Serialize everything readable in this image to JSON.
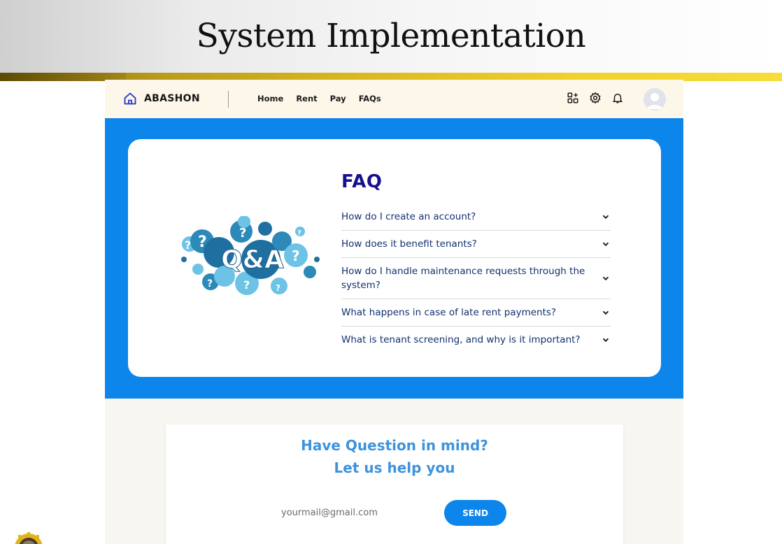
{
  "slide": {
    "title": "System Implementation"
  },
  "navbar": {
    "brand": "ABASHON",
    "links": [
      "Home",
      "Rent",
      "Pay",
      "FAQs"
    ],
    "icons": [
      "apps-add-icon",
      "gear-icon",
      "bell-icon"
    ]
  },
  "faq": {
    "title": "FAQ",
    "image_text": "Q&A",
    "items": [
      {
        "question": "How do I create an account?"
      },
      {
        "question": "How does it benefit tenants?"
      },
      {
        "question": "How do I handle maintenance requests through the system?"
      },
      {
        "question": "What happens in case of late rent payments?"
      },
      {
        "question": "What is tenant screening, and why is it important?"
      }
    ]
  },
  "help": {
    "line1": "Have Question in mind?",
    "line2": "Let us help you",
    "email_placeholder": "yourmail@gmail.com",
    "send_label": "SEND"
  },
  "colors": {
    "primary": "#0d86ec",
    "faq_title": "#150f92",
    "help_text": "#3d93de",
    "gold": "#d9b81f"
  }
}
